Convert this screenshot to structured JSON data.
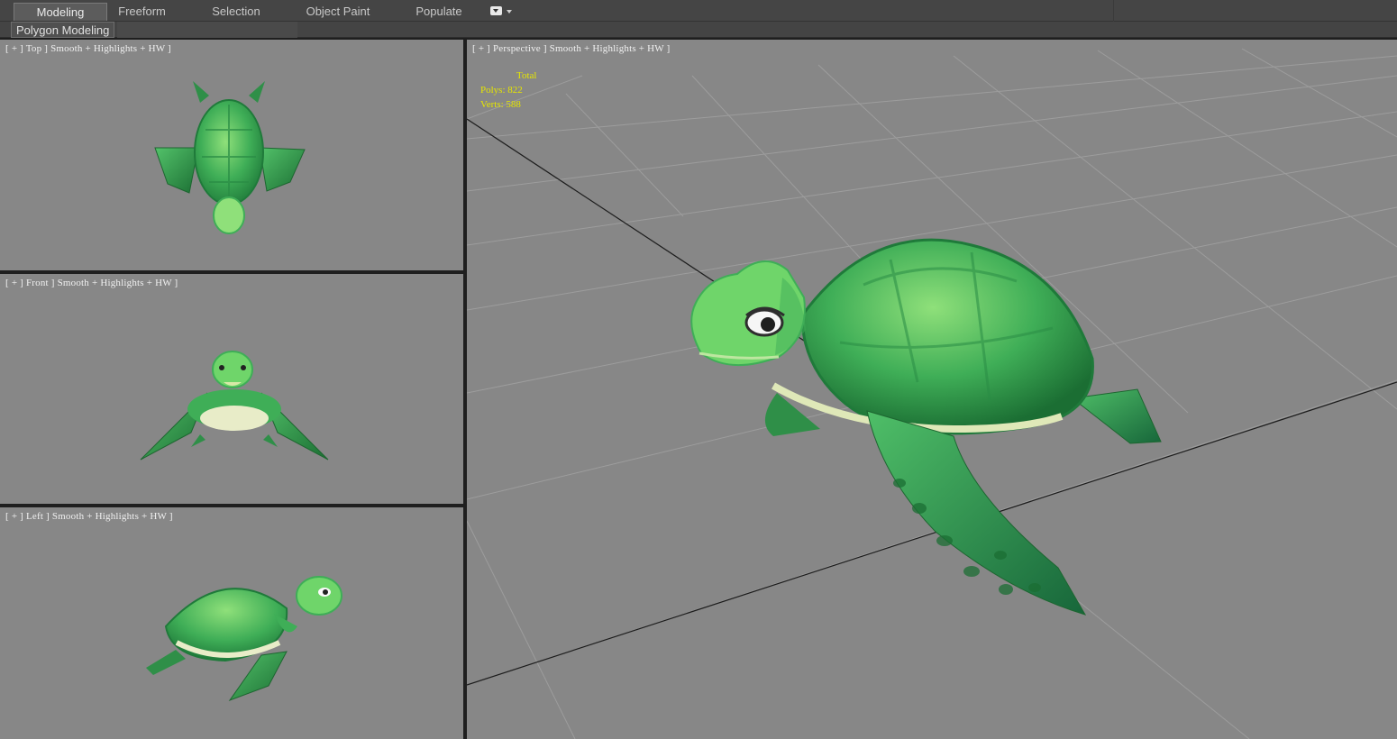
{
  "ribbon": {
    "tabs": [
      {
        "label": "Modeling",
        "active": true
      },
      {
        "label": "Freeform",
        "active": false
      },
      {
        "label": "Selection",
        "active": false
      },
      {
        "label": "Object Paint",
        "active": false
      },
      {
        "label": "Populate",
        "active": false
      }
    ],
    "options_icon": "ribbon-options-dropdown-icon",
    "panel_tab_label": "Polygon Modeling"
  },
  "viewports": {
    "top": {
      "label": "[ + ] Top ] Smooth + Highlights + HW ]"
    },
    "front": {
      "label": "[ + ] Front ] Smooth + Highlights + HW ]"
    },
    "left": {
      "label": "[ + ] Left ] Smooth + Highlights + HW ]"
    },
    "perspective": {
      "label": "[ + ] Perspective ] Smooth + Highlights + HW ]",
      "stats": {
        "header": "Total",
        "polys": "Polys: 822",
        "verts": "Verts: 588"
      }
    }
  },
  "colors": {
    "viewport_bg": "#878787",
    "grid_line": "#9d9d9d",
    "stats_text": "#e6e600",
    "model_green": "#3fae57"
  }
}
